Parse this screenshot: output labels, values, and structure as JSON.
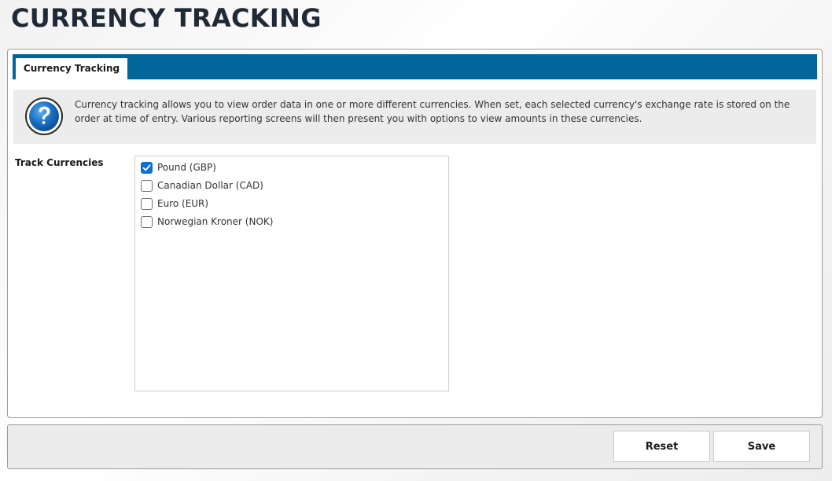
{
  "page": {
    "title": "CURRENCY TRACKING"
  },
  "tabs": [
    {
      "label": "Currency Tracking",
      "active": true
    }
  ],
  "info": {
    "icon": "help-question-icon",
    "text": "Currency tracking allows you to view order data in one or more different currencies. When set, each selected currency's exchange rate is stored on the order at time of entry. Various reporting screens will then present you with options to view amounts in these currencies."
  },
  "track_currencies": {
    "label": "Track Currencies",
    "options": [
      {
        "label": "Pound (GBP)",
        "checked": true
      },
      {
        "label": "Canadian Dollar (CAD)",
        "checked": false
      },
      {
        "label": "Euro (EUR)",
        "checked": false
      },
      {
        "label": "Norwegian Kroner (NOK)",
        "checked": false
      }
    ]
  },
  "footer": {
    "reset_label": "Reset",
    "save_label": "Save"
  },
  "colors": {
    "tab_strip": "#00669a",
    "checkbox_checked": "#0b6fd6",
    "title": "#1f2a36"
  }
}
